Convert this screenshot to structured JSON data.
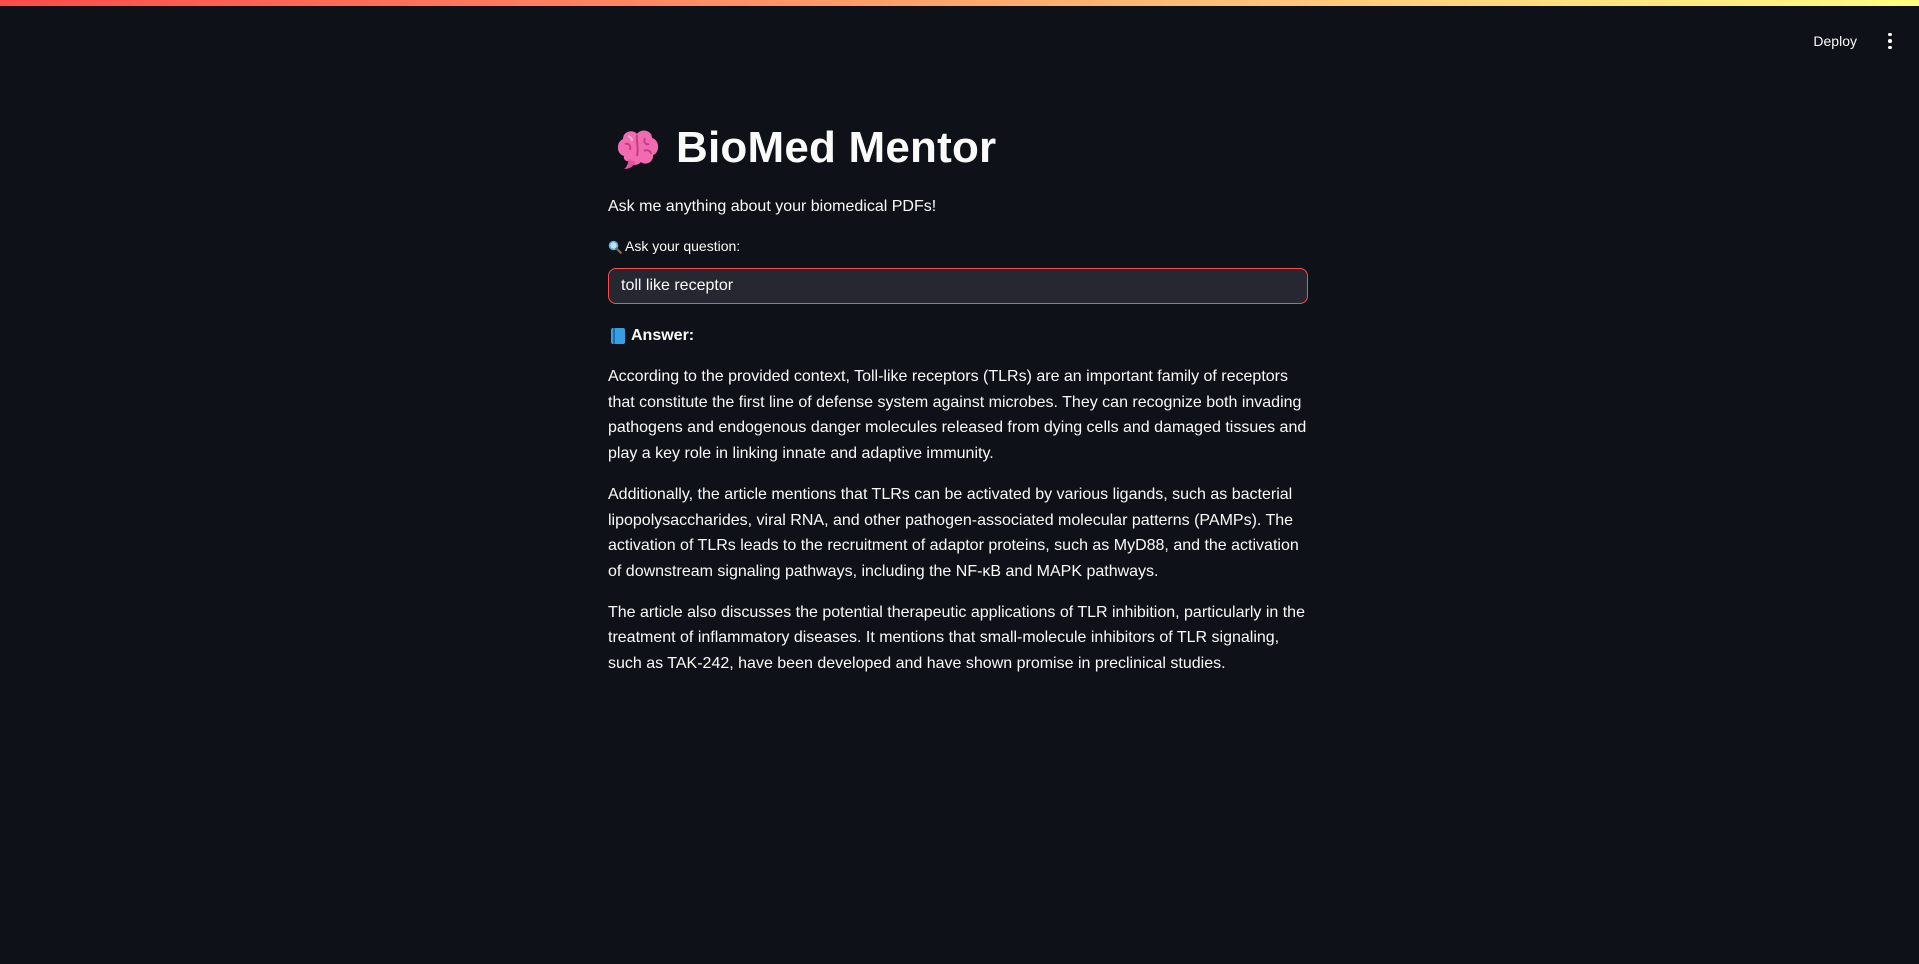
{
  "header": {
    "deploy_label": "Deploy"
  },
  "app": {
    "title": "BioMed Mentor",
    "subtitle": "Ask me anything about your biomedical PDFs!",
    "input_label": "Ask your question:",
    "input_value": "toll like receptor",
    "answer_heading": "Answer:",
    "answer_paragraphs": [
      "According to the provided context, Toll-like receptors (TLRs) are an important family of receptors that constitute the first line of defense system against microbes. They can recognize both invading pathogens and endogenous danger molecules released from dying cells and damaged tissues and play a key role in linking innate and adaptive immunity.",
      "Additionally, the article mentions that TLRs can be activated by various ligands, such as bacterial lipopolysaccharides, viral RNA, and other pathogen-associated molecular patterns (PAMPs). The activation of TLRs leads to the recruitment of adaptor proteins, such as MyD88, and the activation of downstream signaling pathways, including the NF-κB and MAPK pathways.",
      "The article also discusses the potential therapeutic applications of TLR inhibition, particularly in the treatment of inflammatory diseases. It mentions that small-molecule inhibitors of TLR signaling, such as TAK-242, have been developed and have shown promise in preclinical studies."
    ]
  },
  "icons": {
    "title_icon": "brain-icon",
    "label_icon": "magnifying-glass-icon",
    "answer_icon": "blue-book-icon",
    "menu_icon": "vertical-dots-icon"
  },
  "colors": {
    "background": "#0e1117",
    "text": "#fafafa",
    "input_background": "#262730",
    "input_focus_border": "#ff4b4b",
    "accent_gradient_start": "#ff4b4b",
    "accent_gradient_end": "#fffd80"
  }
}
